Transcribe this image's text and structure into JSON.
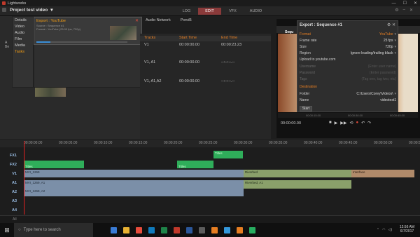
{
  "window": {
    "title": "Lightworks",
    "min": "—",
    "max": "☐",
    "close": "✕"
  },
  "project": {
    "title": "Project test video",
    "chevron": "▾"
  },
  "tabs": [
    "LOG",
    "EDIT",
    "VFX",
    "AUDIO"
  ],
  "active_tab": "EDIT",
  "sidebar": {
    "items": [
      "Details",
      "Video",
      "Audio",
      "Film",
      "Media",
      "Tasks"
    ],
    "active": "Tasks"
  },
  "left_letters": [
    "A",
    "Be"
  ],
  "yt_popup": {
    "title": "Export : YouTube",
    "line1": "Source : Sequence #1",
    "line2": "Format : YouTube (25.00 fps, 720p)",
    "progress": 0.15,
    "close": "✕"
  },
  "audio_network": {
    "a": "Audio Network",
    "b": "Pond5"
  },
  "table": {
    "headers": [
      "Tracks",
      "Start Time",
      "End Time"
    ],
    "rows": [
      [
        "V1",
        "00:00:00.00",
        "00:00:23.23"
      ],
      [
        "V1, A1",
        "00:00:00.00",
        "--:--:--.--"
      ],
      [
        "V1, A1,A2",
        "00:00:00.00",
        "--:--:--.--"
      ]
    ]
  },
  "viewer": {
    "label": "Sequ",
    "timecode": "00:00:00.00",
    "ruler": [
      "00:00:15.00",
      "00:00:30.00",
      "00:00:45.00"
    ]
  },
  "export": {
    "title": "Export : Sequence #1",
    "format_section": "Format",
    "format_value": "YouTube",
    "rows": [
      {
        "label": "Frame rate",
        "value": "25 fps"
      },
      {
        "label": "Size",
        "value": "720p"
      },
      {
        "label": "Region",
        "value": "Ignore leading/trailing black"
      },
      {
        "label": "Upload to youtube.com",
        "value": ""
      }
    ],
    "dim_rows": [
      {
        "label": "Username",
        "value": "(Enter user name)"
      },
      {
        "label": "Password",
        "value": "(Enter password)"
      },
      {
        "label": "Tags",
        "value": "(Tag one, tag two, etc)"
      }
    ],
    "dest_section": "Destination",
    "folder_label": "Folder",
    "folder_value": "C:\\Users\\Corey\\Videos\\",
    "name_label": "Name",
    "name_value": "videotest1",
    "start": "Start"
  },
  "timeline": {
    "ruler": [
      "00:00:00.00",
      "00:00:05.00",
      "00:00:10.00",
      "00:00:15.00",
      "00:00:20.00",
      "00:00:25.00",
      "00:00:30.00",
      "00:00:35.00",
      "00:00:40.00",
      "00:00:45.00",
      "00:00:50.00",
      "00:00:55.00"
    ],
    "tracks": [
      "FX1",
      "FX2",
      "V1",
      "A1",
      "A2",
      "A3",
      "A4"
    ],
    "clips": {
      "titles1": "Titles",
      "titles2": "Titles",
      "titles3": "Titles",
      "v1": "MVI_1269",
      "v1b": "Riverbed",
      "v1c": "Interface",
      "a1": "MVI_1269, A1",
      "a1b": "Riverbed, A1",
      "a2": "MVI_1269, A2"
    },
    "bottom": "All"
  },
  "taskbar": {
    "search": "Type here to search",
    "time": "12:56 AM",
    "date": "6/7/2017",
    "apps": [
      "#3a7bd5",
      "#e8b233",
      "#e74c3c",
      "#0f7bbd",
      "#1e8449",
      "#c0392b",
      "#2b579a",
      "#5c5c5c",
      "#e67e22",
      "#3498db",
      "#e67e22",
      "#27ae60"
    ]
  }
}
